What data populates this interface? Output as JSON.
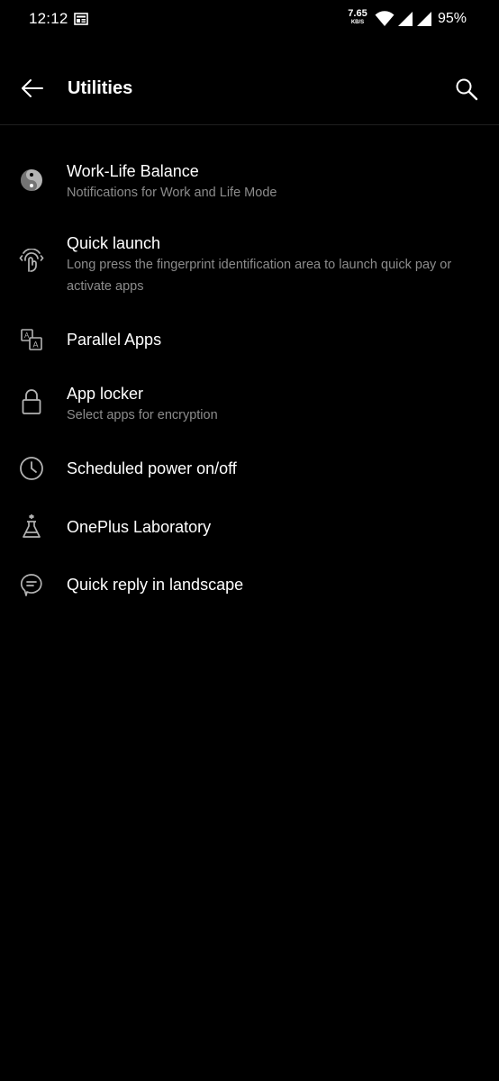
{
  "status_bar": {
    "time": "12:12",
    "net_speed_value": "7.65",
    "net_speed_unit": "KB/S",
    "battery": "95%"
  },
  "header": {
    "title": "Utilities",
    "back_icon": "arrow-left-icon",
    "search_icon": "search-icon"
  },
  "items": [
    {
      "title": "Work-Life Balance",
      "subtitle": "Notifications for Work and Life Mode",
      "icon": "yin-yang-icon"
    },
    {
      "title": "Quick launch",
      "subtitle": "Long press the fingerprint identification area to launch quick pay or activate apps",
      "icon": "fingerprint-touch-icon"
    },
    {
      "title": "Parallel Apps",
      "icon": "parallel-apps-icon"
    },
    {
      "title": "App locker",
      "subtitle": "Select apps for encryption",
      "icon": "lock-icon"
    },
    {
      "title": "Scheduled power on/off",
      "icon": "clock-icon"
    },
    {
      "title": "OnePlus Laboratory",
      "icon": "flask-icon"
    },
    {
      "title": "Quick reply in landscape",
      "icon": "chat-bubble-icon"
    }
  ],
  "colors": {
    "background": "#000000",
    "title_text": "#ffffff",
    "subtitle_text": "#8c8c8c",
    "icon": "#b3b3b3"
  }
}
